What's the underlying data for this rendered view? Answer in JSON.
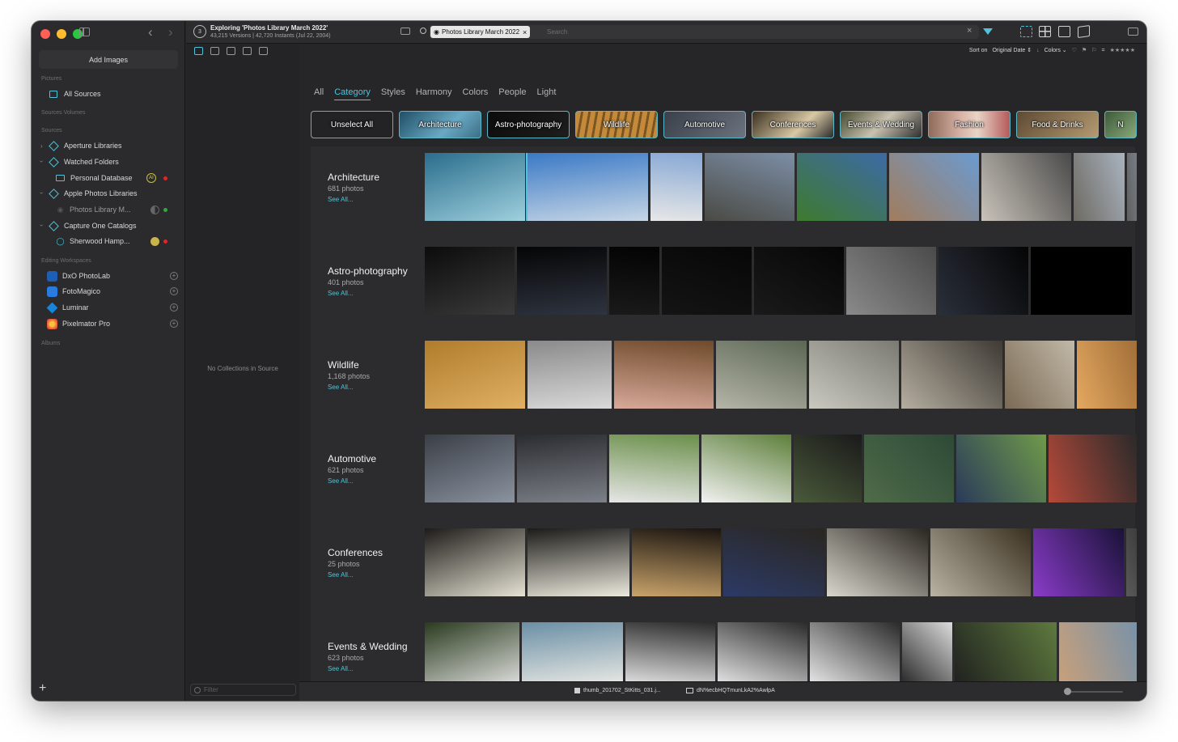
{
  "window": {
    "title": "Exploring 'Photos Library March 2022'",
    "subtitle": "43,215 Versions | 42,720 Instants (Jul 22, 2004)"
  },
  "sidebar": {
    "add_images": "Add Images",
    "sections": {
      "pictures": "Pictures",
      "sources_volumes": "Sources Volumes",
      "sources": "Sources",
      "editing_workspaces": "Editing Workspaces",
      "albums": "Albums"
    },
    "all_sources": "All Sources",
    "sources": [
      {
        "label": "Aperture Libraries"
      },
      {
        "label": "Watched Folders"
      },
      {
        "label": "Personal Database",
        "badge": "AI"
      },
      {
        "label": "Apple Photos Libraries"
      },
      {
        "label": "Photos Library M..."
      },
      {
        "label": "Capture One Catalogs"
      },
      {
        "label": "Sherwood Hamp..."
      }
    ],
    "workspaces": [
      {
        "label": "DxO PhotoLab",
        "color": "#1c5fb4"
      },
      {
        "label": "FotoMagico",
        "color": "#2a7be0"
      },
      {
        "label": "Luminar",
        "color": "#1a84d8"
      },
      {
        "label": "Pixelmator Pro",
        "color": "#e8533a"
      }
    ]
  },
  "collections": {
    "empty": "No Collections in Source",
    "filter_placeholder": "Filter"
  },
  "search": {
    "token": "Photos Library March 2022",
    "placeholder": "Search"
  },
  "sortbar": {
    "sort_on": "Sort on",
    "sort_value": "Original Date",
    "colors": "Colors",
    "equals": "=",
    "stars": "★★★★★"
  },
  "tabs": [
    "All",
    "Category",
    "Styles",
    "Harmony",
    "Colors",
    "People",
    "Light"
  ],
  "active_tab": "Category",
  "chips": [
    "Unselect All",
    "Architecture",
    "Astro-photography",
    "Wildlife",
    "Automotive",
    "Conferences",
    "Events & Wedding",
    "Fashion",
    "Food & Drinks",
    "N"
  ],
  "categories": [
    {
      "title": "Architecture",
      "count": "681 photos",
      "see_all": "See All..."
    },
    {
      "title": "Astro-photography",
      "count": "401 photos",
      "see_all": "See All..."
    },
    {
      "title": "Wildlife",
      "count": "1,168 photos",
      "see_all": "See All..."
    },
    {
      "title": "Automotive",
      "count": "621 photos",
      "see_all": "See All..."
    },
    {
      "title": "Conferences",
      "count": "25 photos",
      "see_all": "See All..."
    },
    {
      "title": "Events & Wedding",
      "count": "623 photos",
      "see_all": "See All..."
    }
  ],
  "bottombar": {
    "file_a": "thumb_201702_StKitts_031.j...",
    "file_b": "dN%ecbHQTmunLkA2%AwlpA"
  },
  "accent_color": "#4fc3d9"
}
